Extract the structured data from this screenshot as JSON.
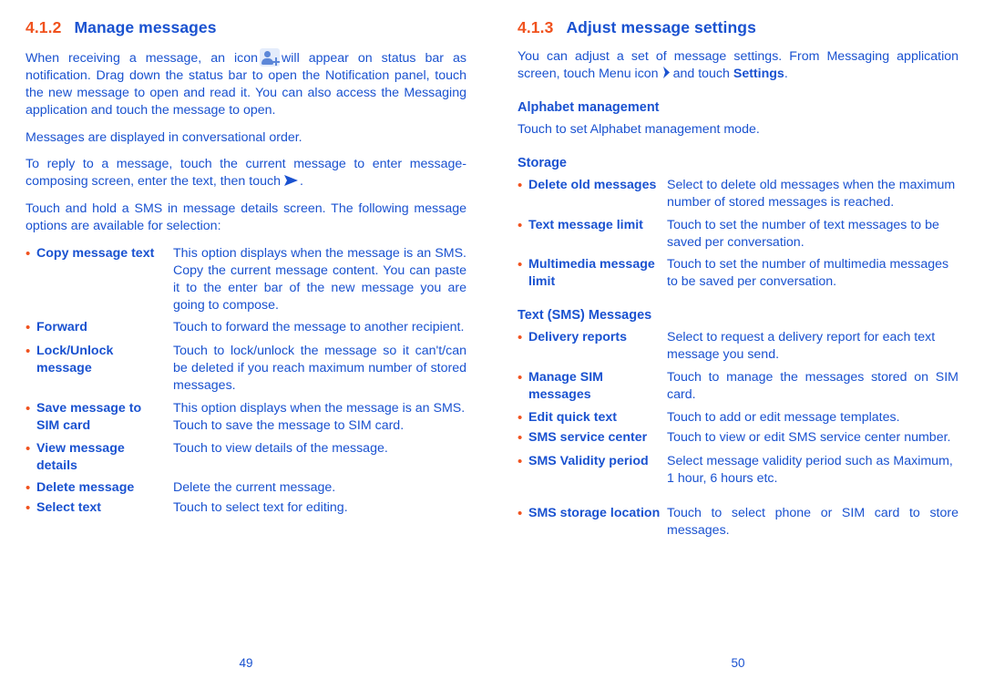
{
  "colors": {
    "primary_blue": "#1a52d0",
    "accent_orange": "#f0521e",
    "icon_blue": "#5c87d8",
    "icon_bg": "#e4ecfb"
  },
  "left_page": {
    "page_number": "49",
    "section_number": "4.1.2",
    "section_title": "Manage messages",
    "paragraph_1_part_a": "When receiving a message, an icon",
    "paragraph_1_part_b": "will appear on status bar as notification. Drag down the status bar to open the Notification panel, touch the new message to open and read it. You can also access the Messaging application and touch the message to open.",
    "paragraph_2": "Messages are displayed in conversational order.",
    "paragraph_3_part_a": "To reply to a message, touch the current message to enter message-composing screen, enter the text, then touch",
    "paragraph_3_part_b": ".",
    "paragraph_4": "Touch and hold a SMS in message details screen. The following message options are available for selection:",
    "options": [
      {
        "bullet": "•",
        "term": "Copy message text",
        "description": "This option displays when the message is an SMS. Copy the current message content. You can paste it to the enter bar of the new message you are going to compose."
      },
      {
        "bullet": "•",
        "term": "Forward",
        "description": "Touch to forward the message to another recipient."
      },
      {
        "bullet": "•",
        "term": "Lock/Unlock message",
        "description": "Touch to lock/unlock the message so it can't/can be deleted if you reach maximum number of stored messages."
      },
      {
        "bullet": "•",
        "term": "Save message to SIM card",
        "description": "This option displays when the message is an SMS. Touch to save the message to SIM card."
      },
      {
        "bullet": "•",
        "term": "View message details",
        "description": "Touch to view details of the message."
      },
      {
        "bullet": "•",
        "term": "Delete message",
        "description": "Delete the current message."
      },
      {
        "bullet": "•",
        "term": "Select text",
        "description": "Touch to select text for editing."
      }
    ]
  },
  "right_page": {
    "page_number": "50",
    "section_number": "4.1.3",
    "section_title": "Adjust message settings",
    "paragraph_1_part_a": "You can adjust a set of message settings. From Messaging application screen, touch Menu icon",
    "paragraph_1_part_b": "and touch",
    "paragraph_1_bold": "Settings",
    "paragraph_1_part_c": ".",
    "heading_alphabet": "Alphabet management",
    "alphabet_text": "Touch to set Alphabet management mode.",
    "heading_storage": "Storage",
    "storage_options": [
      {
        "bullet": "•",
        "term": "Delete old messages",
        "description": "Select to delete old messages when the maximum number of stored messages is reached."
      },
      {
        "bullet": "•",
        "term": "Text message limit",
        "description": "Touch to set the number of text messages to be saved per conversation."
      },
      {
        "bullet": "•",
        "term": "Multimedia message limit",
        "description": "Touch to set the number of multimedia messages to be saved per conversation."
      }
    ],
    "heading_text_sms": "Text (SMS) Messages",
    "sms_options": [
      {
        "bullet": "•",
        "term": "Delivery reports",
        "description": "Select to request a delivery report for each text message you send."
      },
      {
        "bullet": "•",
        "term": "Manage SIM messages",
        "description": "Touch to manage the messages stored on SIM card."
      },
      {
        "bullet": "•",
        "term": "Edit quick text",
        "description": "Touch to add or edit message templates."
      },
      {
        "bullet": "•",
        "term": "SMS service center",
        "description": "Touch to view or edit SMS service center number."
      },
      {
        "bullet": "•",
        "term": "SMS Validity period",
        "description": "Select message validity period such as Maximum, 1 hour, 6 hours etc."
      },
      {
        "bullet": "•",
        "term": "SMS storage location",
        "description": "Touch to select phone or SIM card to store messages."
      }
    ]
  },
  "icons": {
    "contact_add": "contact-add-icon",
    "send_arrow": "send-arrow-icon",
    "menu_arrow": "menu-arrow-icon"
  }
}
